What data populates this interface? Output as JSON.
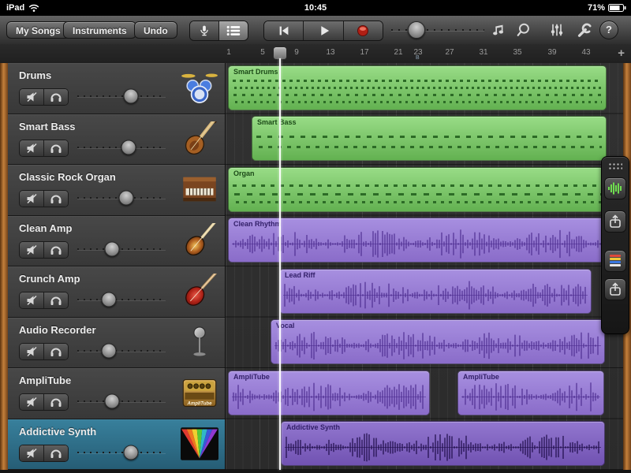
{
  "status_bar": {
    "device": "iPad",
    "time": "10:45",
    "battery": "71%"
  },
  "toolbar": {
    "my_songs": "My Songs",
    "instruments": "Instruments",
    "undo": "Undo",
    "help": "?",
    "master_volume": 28,
    "icons": [
      "microphone-icon",
      "track-headers-icon",
      "rewind-icon",
      "play-icon",
      "record-icon",
      "note-icon",
      "loop-icon",
      "faders-icon",
      "wrench-icon",
      "help-icon"
    ]
  },
  "ruler": {
    "measures": [
      "1",
      "5",
      "9",
      "13",
      "17",
      "21",
      "23",
      "27",
      "31",
      "35",
      "39",
      "43"
    ],
    "section": "B",
    "add": "+"
  },
  "tracks": [
    {
      "name": "Drums",
      "icon": "drum-kit-icon",
      "volume": 60,
      "selected": false
    },
    {
      "name": "Smart Bass",
      "icon": "bass-guitar-icon",
      "volume": 58,
      "selected": false
    },
    {
      "name": "Classic Rock Organ",
      "icon": "organ-icon",
      "volume": 55,
      "selected": false
    },
    {
      "name": "Clean Amp",
      "icon": "electric-guitar-icon",
      "volume": 40,
      "selected": false
    },
    {
      "name": "Crunch Amp",
      "icon": "red-guitar-icon",
      "volume": 36,
      "selected": false
    },
    {
      "name": "Audio Recorder",
      "icon": "studio-mic-icon",
      "volume": 36,
      "selected": false
    },
    {
      "name": "AmpliTube",
      "icon": "amp-icon",
      "icon_label": "AmpliTube",
      "volume": 40,
      "selected": false
    },
    {
      "name": "Addictive Synth",
      "icon": "rainbow-synth-icon",
      "volume": 60,
      "selected": true
    }
  ],
  "regions": [
    {
      "label": "Smart Drums",
      "type": "midi"
    },
    {
      "label": "Smart Bass",
      "type": "midi"
    },
    {
      "label": "Organ",
      "type": "midi"
    },
    {
      "label": "Clean Rhythm",
      "type": "audio"
    },
    {
      "label": "Lead Riff",
      "type": "audio"
    },
    {
      "label": "Vocal",
      "type": "audio"
    },
    {
      "label": "AmpliTube",
      "type": "audio"
    },
    {
      "label": "AmpliTube",
      "type": "audio"
    },
    {
      "label": "Addictive Synth",
      "type": "audio"
    }
  ],
  "side_panel": {
    "icons": [
      "grip-icon",
      "green-waveform-icon",
      "share-icon",
      "palette-icon",
      "share-icon"
    ]
  },
  "colors": {
    "green_region": "#7ccb6a",
    "purple_region": "#9b7fd6",
    "selected_track": "#2f6d85",
    "record": "#e03a2f",
    "playhead": "#ffffff"
  }
}
